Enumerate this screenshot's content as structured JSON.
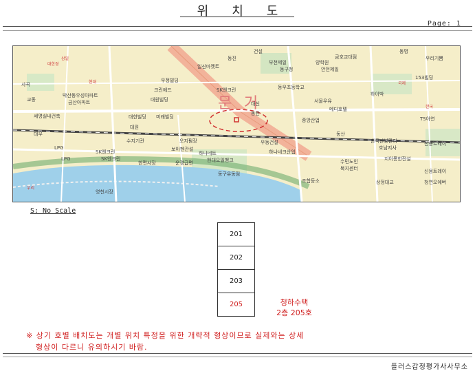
{
  "header": {
    "title": "위치도",
    "page_label": "Page: 1"
  },
  "map": {
    "big_labels": [
      "문",
      "거"
    ],
    "labels": [
      "일신마켓트",
      "우정빌딩",
      "크린에드",
      "미래빌딩",
      "대한빌딩",
      "세명실내건축",
      "박산동우성아파트",
      "금산아파트",
      "SK엔크린",
      "대신",
      "동탄",
      "부천제일",
      "동우초등학교",
      "양학원",
      "서울우유",
      "메디호텔",
      "하이박",
      "153빌딩",
      "우리기쁨",
      "동구청",
      "하나네트",
      "수지기관",
      "오지펌장",
      "보아펜관설",
      "우동건설",
      "하나네크산업",
      "한국난방관리",
      "호남지사",
      "신용트레이",
      "수민노인",
      "복지센터",
      "지이롱한전설",
      "신용트레이",
      "청연오에버",
      "상정대교",
      "현대오일뱅크",
      "SK엔크린",
      "LPG",
      "한편사장",
      "운경급면",
      "동구유동점",
      "조합등소",
      "대우",
      "영천시장",
      "사곡",
      "대원빌딩",
      "TS아연",
      "중앙산업",
      "안전제일",
      "금호교대점",
      "대한경",
      "현대",
      "국제",
      "한국",
      "삼일",
      "우리",
      "SK엔크린",
      "동진",
      "동명",
      "건설",
      "동산",
      "LPG",
      "대원",
      "교동"
    ]
  },
  "scale_label": "S: No Scale",
  "units": [
    {
      "label": "201",
      "highlight": false
    },
    {
      "label": "202",
      "highlight": false
    },
    {
      "label": "203",
      "highlight": false
    },
    {
      "label": "205",
      "highlight": true
    }
  ],
  "callout": {
    "line1": "청하수택",
    "line2": "2층 205호"
  },
  "note": {
    "line1": "※ 상기 호별 배치도는 개별 위치 특정을 위한 개략적 형상이므로 실제와는 상세",
    "line2": "형상이 다르니 유의하시기 바람."
  },
  "footer": {
    "office": "플러스감정평가사사무소"
  }
}
